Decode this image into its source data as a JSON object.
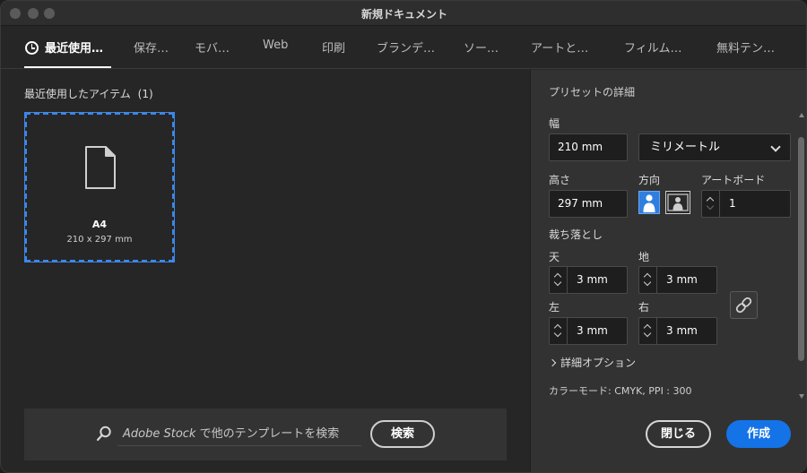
{
  "window": {
    "title": "新規ドキュメント"
  },
  "tabs": [
    {
      "label": "最近使用…",
      "active": true
    },
    {
      "label": "保存…"
    },
    {
      "label": "モバ…"
    },
    {
      "label": "Web"
    },
    {
      "label": "印刷"
    },
    {
      "label": "ブランデ…"
    },
    {
      "label": "ソー…"
    },
    {
      "label": "アートと…"
    },
    {
      "label": "フィルム…"
    },
    {
      "label": "無料テン…"
    }
  ],
  "recent": {
    "title": "最近使用したアイテム",
    "count": "(1)",
    "items": [
      {
        "name": "A4",
        "size": "210 x 297 mm"
      }
    ]
  },
  "search": {
    "brand": "Adobe Stock",
    "placeholder_rest": " で他のテンプレートを検索",
    "button": "検索"
  },
  "preset": {
    "title": "プリセットの詳細",
    "width_label": "幅",
    "width_value": "210 mm",
    "unit": "ミリメートル",
    "height_label": "高さ",
    "height_value": "297 mm",
    "orientation_label": "方向",
    "artboard_label": "アートボード",
    "artboard_value": "1",
    "bleed_label": "裁ち落とし",
    "bleed": {
      "top_label": "天",
      "top": "3 mm",
      "bottom_label": "地",
      "bottom": "3 mm",
      "left_label": "左",
      "left": "3 mm",
      "right_label": "右",
      "right": "3 mm"
    },
    "advanced_label": "詳細オプション",
    "color_mode": "カラーモード: CMYK, PPI : 300"
  },
  "actions": {
    "close": "閉じる",
    "create": "作成"
  },
  "colors": {
    "accent": "#1473e6",
    "selection": "#3c87e8"
  }
}
